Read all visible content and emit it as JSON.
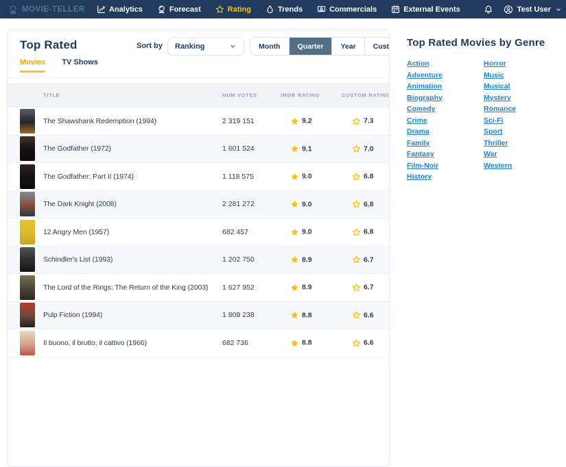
{
  "header": {
    "brand": "MOVIE-TELLER",
    "logo_icon": "crystal-ball-logo-icon",
    "nav_items": [
      {
        "label": "Analytics",
        "icon": "line-chart-icon",
        "active": false
      },
      {
        "label": "Forecast",
        "icon": "crystal-ball-icon",
        "active": false
      },
      {
        "label": "Rating",
        "icon": "star-icon",
        "active": true
      },
      {
        "label": "Trends",
        "icon": "drop-icon",
        "active": false
      },
      {
        "label": "Commercials",
        "icon": "tv-icon",
        "active": false
      },
      {
        "label": "External Events",
        "icon": "calendar-icon",
        "active": false
      }
    ],
    "notifications_icon": "bell-icon",
    "user_name": "Test User"
  },
  "main": {
    "title": "Top Rated",
    "sort_label": "Sort by",
    "sort_value": "Ranking",
    "period_options": [
      "Month",
      "Quarter",
      "Year",
      "Custom"
    ],
    "period_selected": "Quarter",
    "tabs": [
      {
        "label": "Movies",
        "active": true
      },
      {
        "label": "TV Shows",
        "active": false
      }
    ],
    "table": {
      "columns": [
        "TITLE",
        "NUM VOTES",
        "IMDB RATING",
        "CUSTOM RATING"
      ],
      "rows": [
        {
          "title": "The Shawshank Redemption (1994)",
          "votes": "2 319 151",
          "imdb": "9.2",
          "custom": "7.3",
          "poster_colors": [
            "#5a5f66",
            "#23252b",
            "#9c6a2c"
          ]
        },
        {
          "title": "The Godfather (1972)",
          "votes": "1 601 524",
          "imdb": "9.1",
          "custom": "7.0",
          "poster_colors": [
            "#42322a",
            "#121010",
            "#0b0a0a"
          ]
        },
        {
          "title": "The Godfather: Part II (1974)",
          "votes": "1 118 575",
          "imdb": "9.0",
          "custom": "6.8",
          "poster_colors": [
            "#2b2320",
            "#141111",
            "#0b0a0a"
          ]
        },
        {
          "title": "The Dark Knight (2008)",
          "votes": "2 281 272",
          "imdb": "9.0",
          "custom": "6.8",
          "poster_colors": [
            "#7d8c9a",
            "#8a4c33",
            "#2b3a46"
          ]
        },
        {
          "title": "12 Angry Men (1957)",
          "votes": "682 457",
          "imdb": "9.0",
          "custom": "6.8",
          "poster_colors": [
            "#e3c532",
            "#d9b92a",
            "#caa81f"
          ]
        },
        {
          "title": "Schindler's List (1993)",
          "votes": "1 202 750",
          "imdb": "8.9",
          "custom": "6.7",
          "poster_colors": [
            "#555555",
            "#2a2a2a",
            "#161616"
          ]
        },
        {
          "title": "The Lord of the Rings: The Return of the King (2003)",
          "votes": "1 627 952",
          "imdb": "8.9",
          "custom": "6.7",
          "poster_colors": [
            "#7a7257",
            "#4b4436",
            "#2c2820"
          ]
        },
        {
          "title": "Pulp Fiction (1994)",
          "votes": "1 809 238",
          "imdb": "8.8",
          "custom": "6.6",
          "poster_colors": [
            "#b9372b",
            "#6b4a39",
            "#27201e"
          ]
        },
        {
          "title": "Il buono, il brutto, il cattivo (1966)",
          "votes": "682 736",
          "imdb": "8.8",
          "custom": "6.6",
          "poster_colors": [
            "#e7d7c5",
            "#d4a08e",
            "#c4554a"
          ]
        }
      ]
    }
  },
  "genres_panel": {
    "title": "Top Rated Movies by Genre",
    "columns": [
      [
        "Action",
        "Adventure",
        "Animation",
        "Biography",
        "Comedy",
        "Crime",
        "Drama",
        "Family",
        "Fantasy",
        "Film-Noir",
        "History"
      ],
      [
        "Horror",
        "Music",
        "Musical",
        "Mystery",
        "Romance",
        "Sci-Fi",
        "Sport",
        "Thriller",
        "War",
        "Western"
      ]
    ]
  },
  "colors": {
    "header_bg": "#213a5e",
    "accent_yellow": "#f8c31c",
    "tab_underline": "#fcc419",
    "link_blue": "#2084cc",
    "segment_selected_bg": "#527086",
    "heading_navy": "#1e3a66",
    "star_gold": "#fcbf17"
  }
}
